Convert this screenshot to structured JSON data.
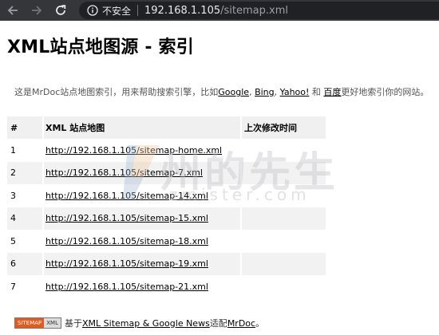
{
  "browser": {
    "security_label": "不安全",
    "url_host": "192.168.1.105",
    "url_path": "/sitemap.xml"
  },
  "page": {
    "title": "XML站点地图源 - 索引",
    "intro": {
      "prefix": "这是MrDoc站点地图索引，用来帮助搜索引擎，比如",
      "link_google": "Google",
      "sep1": ", ",
      "link_bing": "Bing",
      "sep2": ", ",
      "link_yahoo": "Yahoo!",
      "and": " 和 ",
      "link_baidu": "百度",
      "suffix": "更好地索引你的网站。"
    }
  },
  "table": {
    "headers": [
      "#",
      "XML 站点地图",
      "上次修改时间"
    ],
    "rows": [
      {
        "num": "1",
        "url": "http://192.168.1.105/sitemap-home.xml",
        "lastmod": ""
      },
      {
        "num": "2",
        "url": "http://192.168.1.105/sitemap-7.xml",
        "lastmod": ""
      },
      {
        "num": "3",
        "url": "http://192.168.1.105/sitemap-14.xml",
        "lastmod": ""
      },
      {
        "num": "4",
        "url": "http://192.168.1.105/sitemap-15.xml",
        "lastmod": ""
      },
      {
        "num": "5",
        "url": "http://192.168.1.105/sitemap-18.xml",
        "lastmod": ""
      },
      {
        "num": "6",
        "url": "http://192.168.1.105/sitemap-19.xml",
        "lastmod": ""
      },
      {
        "num": "7",
        "url": "http://192.168.1.105/sitemap-21.xml",
        "lastmod": ""
      }
    ]
  },
  "watermark": {
    "main": "州的先生",
    "sub": "zmister.com"
  },
  "footer": {
    "badge_left": "SITEMAP",
    "badge_right": "XML",
    "prefix": "基于",
    "link_plugin": "XML Sitemap & Google News",
    "middle": " 适配 ",
    "link_mrdoc": "MrDoc",
    "suffix": "。"
  },
  "colors": {
    "toolbar_bg": "#35363a",
    "omnibox_bg": "#202124",
    "badge_orange": "#e55a1a",
    "row_alt": "#f2f2f2"
  }
}
